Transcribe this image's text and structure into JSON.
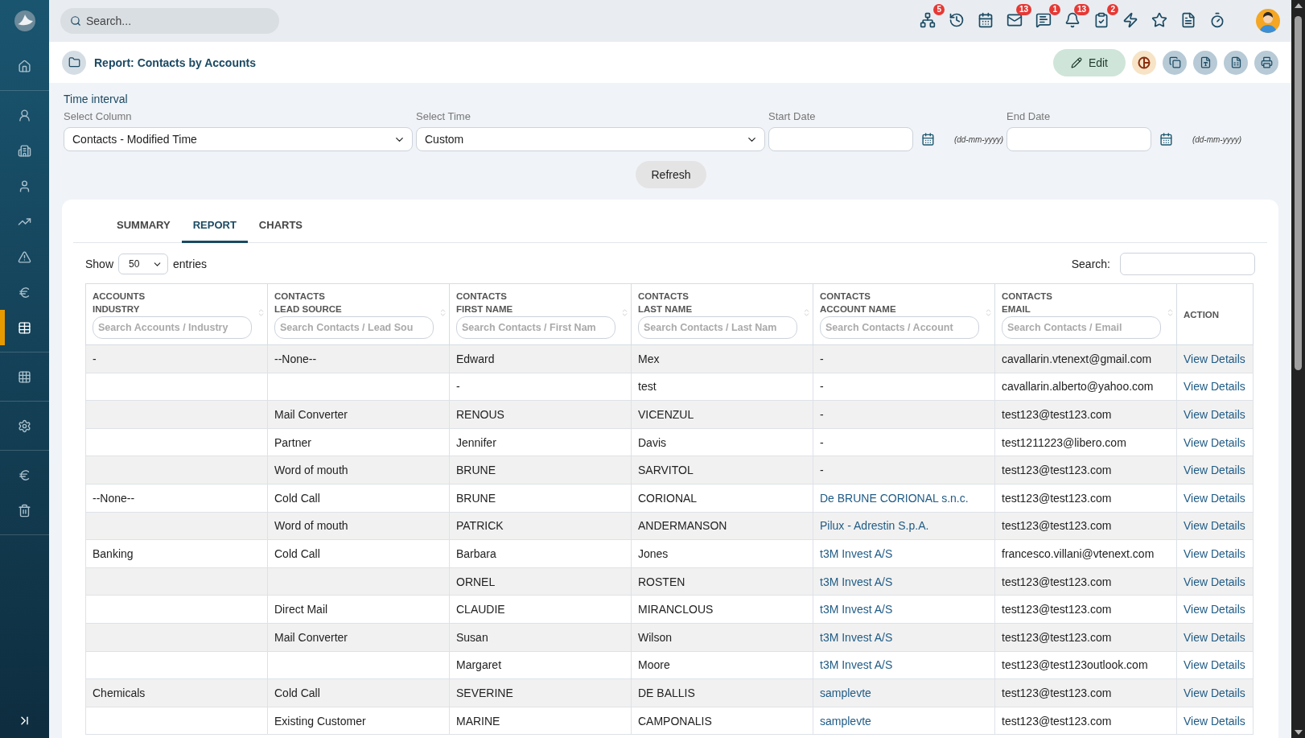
{
  "sidebar": {
    "groups": [
      [
        {
          "selected": false
        }
      ],
      [
        {
          "selected": false
        },
        {
          "selected": false
        },
        {
          "selected": false
        },
        {
          "selected": false
        },
        {
          "selected": false
        },
        {
          "selected": false
        },
        {
          "selected": true
        }
      ],
      [
        {
          "selected": false
        }
      ],
      [
        {
          "selected": false
        }
      ],
      [
        {
          "selected": false
        },
        {
          "selected": false
        }
      ]
    ]
  },
  "topbar": {
    "search": {
      "placeholder": "Search..."
    },
    "icons": [
      {
        "kind": "hierarchy",
        "badge": "5"
      },
      {
        "kind": "history"
      },
      {
        "kind": "calendar"
      },
      {
        "kind": "mail",
        "badge": "13"
      },
      {
        "kind": "chat",
        "badge": "1"
      },
      {
        "kind": "bell",
        "badge": "13"
      },
      {
        "kind": "tasks",
        "badge": "2"
      },
      {
        "kind": "lightning"
      },
      {
        "kind": "star"
      },
      {
        "kind": "document"
      },
      {
        "kind": "stopwatch"
      }
    ]
  },
  "header": {
    "title": "Report: Contacts by Accounts",
    "edit_button": "Edit"
  },
  "filters": {
    "heading": "Time interval",
    "select_column": {
      "label": "Select Column",
      "value": "Contacts - Modified Time"
    },
    "select_time": {
      "label": "Select Time",
      "value": "Custom"
    },
    "start_date": {
      "label": "Start Date",
      "hint": "(dd-mm-yyyy)"
    },
    "end_date": {
      "label": "End Date",
      "hint": "(dd-mm-yyyy)"
    },
    "refresh_button": "Refresh"
  },
  "tabs": [
    {
      "label": "SUMMARY",
      "selected": false
    },
    {
      "label": "REPORT",
      "selected": true
    },
    {
      "label": "CHARTS",
      "selected": false
    }
  ],
  "table_controls": {
    "show_label": "Show",
    "page_size": "50",
    "entries_label": "entries",
    "search_label": "Search:"
  },
  "table": {
    "columns": [
      {
        "group": "ACCOUNTS",
        "name": "INDUSTRY",
        "placeholder": "Search Accounts / Industry"
      },
      {
        "group": "CONTACTS",
        "name": "LEAD SOURCE",
        "placeholder": "Search Contacts / Lead Sou"
      },
      {
        "group": "CONTACTS",
        "name": "FIRST NAME",
        "placeholder": "Search Contacts / First Nam"
      },
      {
        "group": "CONTACTS",
        "name": "LAST NAME",
        "placeholder": "Search Contacts / Last Nam"
      },
      {
        "group": "CONTACTS",
        "name": "ACCOUNT NAME",
        "placeholder": "Search Contacts / Account"
      },
      {
        "group": "CONTACTS",
        "name": "EMAIL",
        "placeholder": "Search Contacts / Email"
      },
      {
        "name": "ACTION"
      }
    ],
    "rows": [
      {
        "industry": "-",
        "lead_source": "--None--",
        "first_name": "Edward",
        "last_name": "Mex",
        "account_name": {
          "text": "-",
          "link": false
        },
        "email": "cavallarin.vtenext@gmail.com",
        "action": "View Details"
      },
      {
        "industry": "",
        "lead_source": "",
        "first_name": "-",
        "last_name": "test",
        "account_name": {
          "text": "-",
          "link": false
        },
        "email": "cavallarin.alberto@yahoo.com",
        "action": "View Details"
      },
      {
        "industry": "",
        "lead_source": "Mail Converter",
        "first_name": "RENOUS",
        "last_name": "VICENZUL",
        "account_name": {
          "text": "-",
          "link": false
        },
        "email": "test123@test123.com",
        "action": "View Details"
      },
      {
        "industry": "",
        "lead_source": "Partner",
        "first_name": "Jennifer",
        "last_name": "Davis",
        "account_name": {
          "text": "-",
          "link": false
        },
        "email": "test1211223@libero.com",
        "action": "View Details"
      },
      {
        "industry": "",
        "lead_source": "Word of mouth",
        "first_name": "BRUNE",
        "last_name": "SARVITOL",
        "account_name": {
          "text": "-",
          "link": false
        },
        "email": "test123@test123.com",
        "action": "View Details"
      },
      {
        "industry": "--None--",
        "lead_source": "Cold Call",
        "first_name": "BRUNE",
        "last_name": "CORIONAL",
        "account_name": {
          "text": "De BRUNE CORIONAL s.n.c.",
          "link": true
        },
        "email": "test123@test123.com",
        "action": "View Details"
      },
      {
        "industry": "",
        "lead_source": "Word of mouth",
        "first_name": "PATRICK",
        "last_name": "ANDERMANSON",
        "account_name": {
          "text": "Pilux - Adrestin S.p.A.",
          "link": true
        },
        "email": "test123@test123.com",
        "action": "View Details"
      },
      {
        "industry": "Banking",
        "lead_source": "Cold Call",
        "first_name": "Barbara",
        "last_name": "Jones",
        "account_name": {
          "text": "t3M Invest A/S",
          "link": true
        },
        "email": "francesco.villani@vtenext.com",
        "action": "View Details"
      },
      {
        "industry": "",
        "lead_source": "",
        "first_name": "ORNEL",
        "last_name": "ROSTEN",
        "account_name": {
          "text": "t3M Invest A/S",
          "link": true
        },
        "email": "test123@test123.com",
        "action": "View Details"
      },
      {
        "industry": "",
        "lead_source": "Direct Mail",
        "first_name": "CLAUDIE",
        "last_name": "MIRANCLOUS",
        "account_name": {
          "text": "t3M Invest A/S",
          "link": true
        },
        "email": "test123@test123.com",
        "action": "View Details"
      },
      {
        "industry": "",
        "lead_source": "Mail Converter",
        "first_name": "Susan",
        "last_name": "Wilson",
        "account_name": {
          "text": "t3M Invest A/S",
          "link": true
        },
        "email": "test123@test123.com",
        "action": "View Details"
      },
      {
        "industry": "",
        "lead_source": "",
        "first_name": "Margaret",
        "last_name": "Moore",
        "account_name": {
          "text": "t3M Invest A/S",
          "link": true
        },
        "email": "test123@test123outlook.com",
        "action": "View Details"
      },
      {
        "industry": "Chemicals",
        "lead_source": "Cold Call",
        "first_name": "SEVERINE",
        "last_name": "DE BALLIS",
        "account_name": {
          "text": "samplevte",
          "link": true
        },
        "email": "test123@test123.com",
        "action": "View Details"
      },
      {
        "industry": "",
        "lead_source": "Existing Customer",
        "first_name": "MARINE",
        "last_name": "CAMPONALIS",
        "account_name": {
          "text": "samplevte",
          "link": true
        },
        "email": "test123@test123.com",
        "action": "View Details"
      }
    ]
  }
}
